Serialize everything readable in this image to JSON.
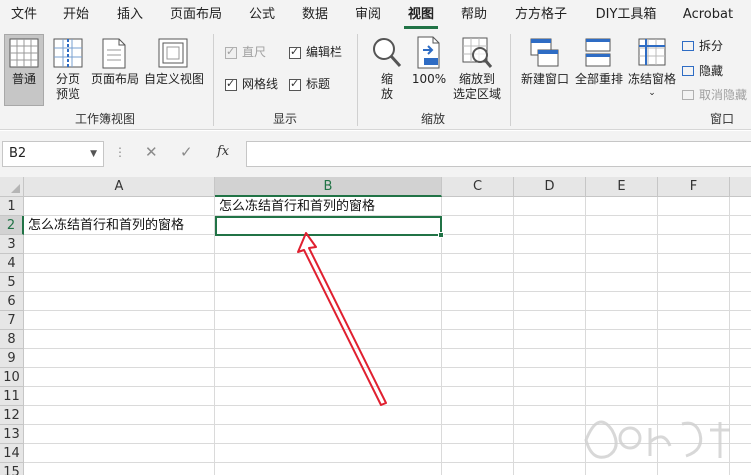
{
  "menu": {
    "tabs": [
      "文件",
      "开始",
      "插入",
      "页面布局",
      "公式",
      "数据",
      "审阅",
      "视图",
      "帮助",
      "方方格子",
      "DIY工具箱",
      "Acrobat"
    ],
    "active": "视图"
  },
  "ribbon": {
    "workbook_views": {
      "normal": "普通",
      "page_break_1": "分页",
      "page_break_2": "预览",
      "page_layout": "页面布局",
      "custom_views": "自定义视图",
      "group_label": "工作簿视图"
    },
    "show": {
      "ruler": "直尺",
      "formula_bar": "编辑栏",
      "gridlines": "网格线",
      "headings": "标题",
      "group_label": "显示"
    },
    "zoom": {
      "zoom_1": "缩",
      "zoom_2": "放",
      "hundred": "100%",
      "zoom_sel_1": "缩放到",
      "zoom_sel_2": "选定区域",
      "group_label": "缩放"
    },
    "window": {
      "new_window": "新建窗口",
      "arrange_all": "全部重排",
      "freeze_panes": "冻结窗格",
      "split": "拆分",
      "hide": "隐藏",
      "unhide": "取消隐藏",
      "group_label": "窗口"
    }
  },
  "formula_bar": {
    "name_box": "B2",
    "dots": "⋮",
    "cancel": "✕",
    "enter": "✓",
    "fx": "fx",
    "value": ""
  },
  "sheet": {
    "columns": [
      "A",
      "B",
      "C",
      "D",
      "E",
      "F"
    ],
    "rows": [
      "1",
      "2",
      "3",
      "4",
      "5",
      "6",
      "7",
      "8",
      "9",
      "10",
      "11",
      "12",
      "13",
      "14",
      "15"
    ],
    "selected_cell": "B2",
    "cells": {
      "B1": "怎么冻结首行和首列的窗格",
      "A2": "怎么冻结首行和首列的窗格"
    }
  },
  "colors": {
    "accent": "#217346",
    "annotation_arrow": "#e02030"
  }
}
